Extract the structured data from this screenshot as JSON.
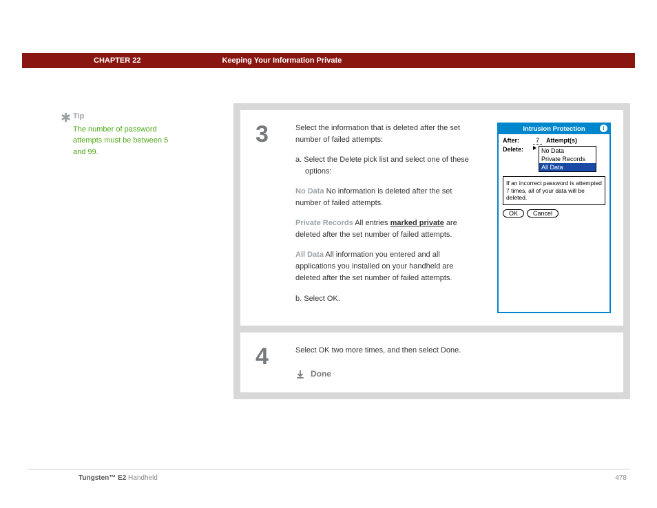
{
  "header": {
    "chapter": "CHAPTER 22",
    "title": "Keeping Your Information Private"
  },
  "tip": {
    "label": "Tip",
    "text": "The number of password attempts must be between 5 and 99."
  },
  "step3": {
    "number": "3",
    "intro": "Select the information that is deleted after the set number of failed attempts:",
    "a": "a.  Select the Delete pick list and select one of these options:",
    "noData": {
      "lead": "No Data",
      "text": "   No information is deleted after the set number of failed attempts."
    },
    "priv": {
      "lead": "Private Records",
      "pre": "   All entries ",
      "markedPrivate": "marked private",
      "post": " are deleted after the set number of failed attempts."
    },
    "allData": {
      "lead": "All Data",
      "text": "   All information you entered and all applications you installed on your handheld are deleted after the set number of failed attempts."
    },
    "b": "b.  Select OK."
  },
  "palm": {
    "title": "Intrusion Protection",
    "afterLabel": "After:",
    "afterValue": "7",
    "attempts": "Attempt(s)",
    "deleteLabel": "Delete:",
    "options": [
      "No Data",
      "Private Records",
      "All Data"
    ],
    "message": "If an incorrect password is attempted 7 times, all of your data will be deleted.",
    "ok": "OK",
    "cancel": "Cancel"
  },
  "step4": {
    "number": "4",
    "text": "Select OK two more times, and then select Done.",
    "done": "Done"
  },
  "footer": {
    "productBold": "Tungsten™ E2",
    "productRest": " Handheld",
    "page": "478"
  }
}
